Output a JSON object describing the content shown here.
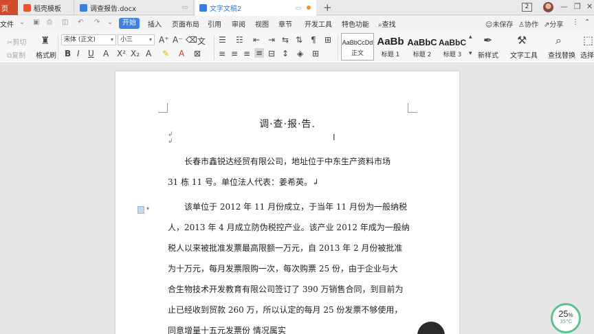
{
  "tabs": {
    "home": "页",
    "items": [
      {
        "label": "稻壳模板",
        "color": "#e8572e"
      },
      {
        "label": "调查报告.docx",
        "color": "#3b7fd9"
      },
      {
        "label": "文字文稿2",
        "color": "#3b7fd9"
      }
    ],
    "new_tab": "+",
    "window_badge": "2"
  },
  "menu": {
    "file": "文件",
    "start": "开始",
    "items": [
      "插入",
      "页面布局",
      "引用",
      "审阅",
      "视图",
      "章节",
      "开发工具",
      "特色功能"
    ],
    "search": "查找",
    "unsaved": "未保存",
    "collab": "协作",
    "share": "分享"
  },
  "ribbon": {
    "cut": "剪切",
    "copy": "复制",
    "format_painter": "格式刷",
    "font_name": "宋体 (正文)",
    "font_size": "小三",
    "styles": [
      {
        "sample": "AaBbCcDd",
        "caption": "正文"
      },
      {
        "sample": "AaBb",
        "caption": "标题 1"
      },
      {
        "sample": "AaBbC",
        "caption": "标题 2"
      },
      {
        "sample": "AaBbC",
        "caption": "标题 3"
      }
    ],
    "new_style": "新样式",
    "text_tools": "文字工具",
    "find_replace": "查找替换",
    "select": "选择"
  },
  "document": {
    "title": "调·查·报·告.",
    "lines": [
      "长春市鑫锐达经贸有限公司，地址位于中东生产资料市场",
      "31 栋 11 号。单位法人代表：姜希英。↲",
      "该单位于 2012 年 11 月份成立，于当年 11 月份为一般纳税",
      "人，2013 年 4 月成立防伪税控产业。该产业 2012 年成为一般纳",
      "税人以来被批准发票最高限额一万元，自 2013 年 2 月份被批准",
      "为十万元，每月发票限购一次，每次购票 25 份，由于企业与大",
      "合生物技术开发教育有限公司签订了 390 万销售合同，到目前为",
      "止已经收到贸款 260 万，所以认定的每月 25 份发票不够使用，",
      "同意增量十五元发票份 情况属实"
    ]
  },
  "status": {
    "progress_percent": "25",
    "progress_unit": "%",
    "temperature": "35°C"
  }
}
